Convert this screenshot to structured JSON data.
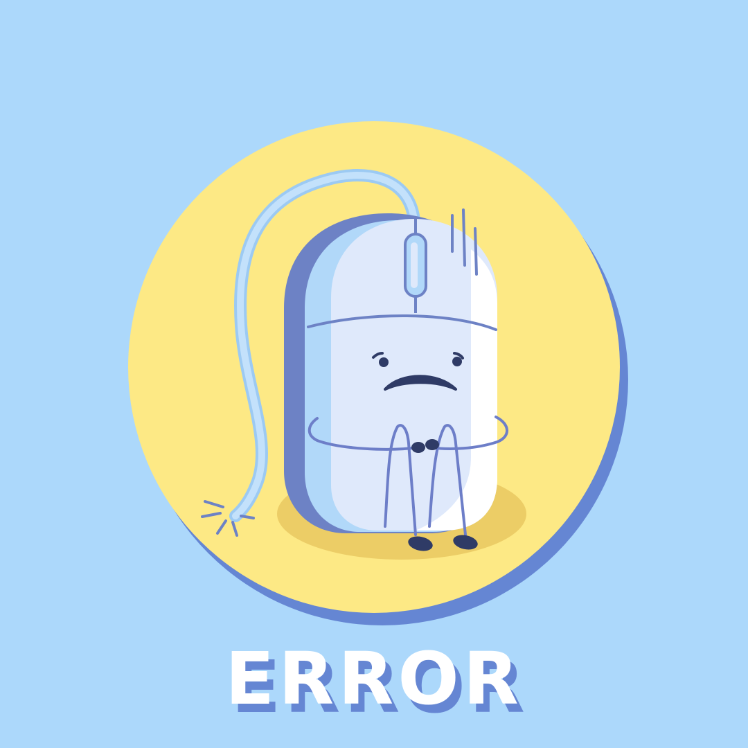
{
  "scene": {
    "caption": "ERROR",
    "icons": [
      "broken-mouse-character-icon",
      "frayed-cable-spark-icon",
      "worry-lines-icon"
    ]
  },
  "colors": {
    "background": "#acd8fb",
    "circle_fill": "#fde985",
    "circle_shadow": "#6586d3",
    "ground_shadow": "#eccd66",
    "mouse_body": "#dfe9fb",
    "mouse_highlight": "#ffffff",
    "mouse_side": "#b1d8f9",
    "mouse_outline": "#6d82c5",
    "line_color": "#6d7ec8",
    "face_color": "#2f3b66",
    "text_color": "#ffffff",
    "text_shadow": "#6586d3"
  }
}
